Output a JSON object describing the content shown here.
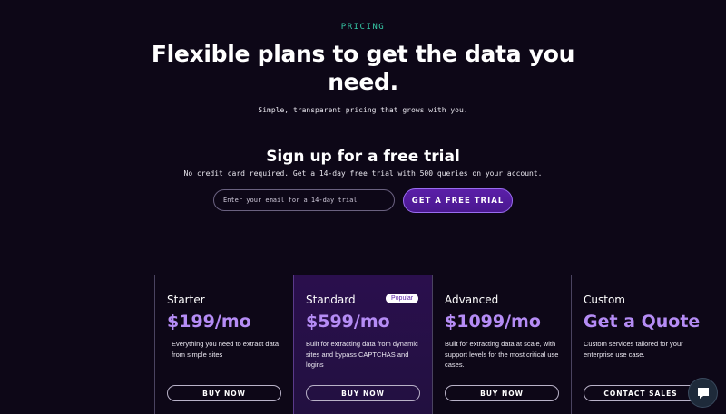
{
  "header": {
    "eyebrow": "PRICING",
    "title": "Flexible plans to get the data you need.",
    "subtitle": "Simple, transparent pricing that grows with you."
  },
  "trial": {
    "title": "Sign up for a free trial",
    "subtitle": "No credit card required. Get a 14-day free trial with 500 queries on your account.",
    "email_placeholder": "Enter your email for a 14-day trial",
    "email_value": "",
    "button_label": "GET A FREE TRIAL"
  },
  "plans": [
    {
      "name": "Starter",
      "price": "$199/mo",
      "description": "Everything you need to extract data from simple sites",
      "button_label": "BUY NOW"
    },
    {
      "name": "Standard",
      "badge": "Popular",
      "price": "$599/mo",
      "description": "Built for extracting data from dynamic sites and bypass CAPTCHAS and logins",
      "button_label": "BUY NOW"
    },
    {
      "name": "Advanced",
      "price": "$1099/mo",
      "description": "Built for extracting data at scale, with support levels for the most critical use cases.",
      "button_label": "BUY NOW"
    },
    {
      "name": "Custom",
      "price": "Get a Quote",
      "description": "Custom services tailored for your enterprise use case.",
      "button_label": "CONTACT SALES"
    }
  ],
  "chat": {
    "icon": "chat-bubble-icon"
  },
  "colors": {
    "background": "#0d0717",
    "accent_teal": "#36c9a7",
    "accent_purple": "#b58cf5",
    "primary_button": "#5b1fa8",
    "featured_card": "#2a0f4d"
  }
}
